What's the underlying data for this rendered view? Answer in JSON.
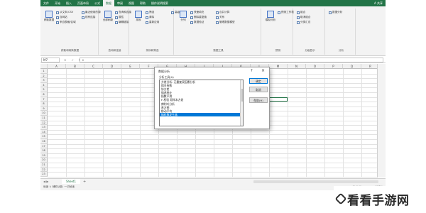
{
  "titlebar": {
    "tabs": [
      "文件",
      "开始",
      "插入",
      "页面布局",
      "公式",
      "数据",
      "审阅",
      "视图",
      "帮助",
      "操作说明搜索"
    ],
    "active_tab": "数据",
    "user": "A 共享"
  },
  "ribbon": {
    "groups": [
      {
        "label": "获取和转换数据",
        "big": "获取数据",
        "items": [
          "从文本/CSV",
          "自网站",
          "来自表格/区域",
          "最近使用的源",
          "现有连接"
        ]
      },
      {
        "label": "查询和连接",
        "big": "全部刷新",
        "items": [
          "查询和连接",
          "属性",
          "编辑链接"
        ]
      },
      {
        "label": "排序和筛选",
        "big": "排序",
        "items": [
          "筛选",
          "清除",
          "重新应用",
          "高级"
        ]
      },
      {
        "label": "数据工具",
        "big": "分列",
        "items": [
          "快速填充",
          "删除重复值",
          "数据验证",
          "合并计算",
          "关系",
          "管理数据模型"
        ]
      },
      {
        "label": "预测",
        "big": "模拟分析",
        "items": [
          "预测工作表"
        ]
      },
      {
        "label": "分级显示",
        "big": "",
        "items": [
          "组合",
          "取消组合",
          "分类汇总"
        ]
      },
      {
        "label": "分析",
        "big": "",
        "items": [
          "数据分析"
        ]
      }
    ]
  },
  "formula_bar": {
    "name_box": "M7",
    "icons": "× ✓ fx",
    "value": ""
  },
  "grid": {
    "columns": [
      "A",
      "B",
      "C",
      "D",
      "E",
      "F",
      "G",
      "H",
      "I",
      "J",
      "K",
      "L",
      "M",
      "N",
      "O",
      "P",
      "Q",
      "R"
    ],
    "rows": [
      "1",
      "2",
      "3",
      "4",
      "5",
      "6",
      "7",
      "8",
      "9",
      "10",
      "11",
      "12",
      "13",
      "14",
      "15",
      "16",
      "17",
      "18",
      "19",
      "20",
      "21",
      "22",
      "23"
    ]
  },
  "sheet": {
    "tab": "Sheet1",
    "add": "+"
  },
  "status": {
    "left": "就绪  ♿ 辅助功能: 一切就绪",
    "right": "▦ ▣ ▤  ━━━━━━━━  100%"
  },
  "dialog": {
    "title": "数据分析",
    "help": "?",
    "close": "×",
    "list_label": "分析工具(A)",
    "tools": [
      "方差分析: 无重复双因素分析",
      "相关系数",
      "协方差",
      "描述统计",
      "指数平滑",
      "F-检验 双样本方差",
      "傅利叶分析",
      "直方图",
      "移动平均",
      "随机数发生器"
    ],
    "selected_tool": "随机数发生器",
    "buttons": {
      "ok": "确定",
      "cancel": "取消",
      "help": "帮助(H)"
    }
  },
  "watermark": {
    "text": "看看手游网"
  }
}
